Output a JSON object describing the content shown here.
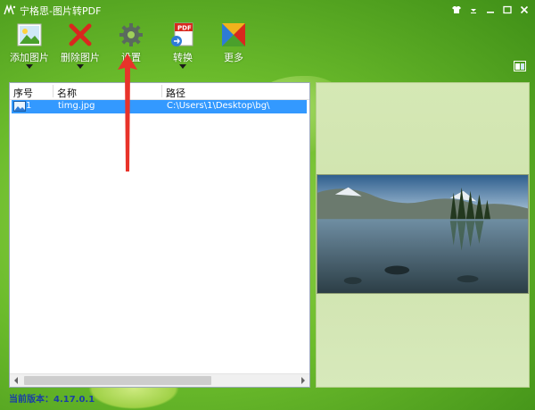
{
  "window": {
    "title": "宁格思-图片转PDF",
    "controls": [
      "shirt-icon",
      "dropdown-icon",
      "minimize-icon",
      "maximize-icon",
      "close-icon"
    ]
  },
  "toolbar": {
    "items": [
      {
        "label": "添加图片",
        "icon": "add-image-icon",
        "has_dropdown": true
      },
      {
        "label": "删除图片",
        "icon": "delete-x-icon",
        "has_dropdown": true
      },
      {
        "label": "设置",
        "icon": "gear-icon",
        "has_dropdown": false
      },
      {
        "label": "转换",
        "icon": "pdf-convert-icon",
        "has_dropdown": true
      },
      {
        "label": "更多",
        "icon": "more-icon",
        "has_dropdown": false
      }
    ]
  },
  "file_list": {
    "columns": [
      "序号",
      "名称",
      "路径"
    ],
    "rows": [
      {
        "index": "1",
        "name": "timg.jpg",
        "path": "C:\\Users\\1\\Desktop\\bg\\",
        "selected": true
      }
    ]
  },
  "status": {
    "version_text": "当前版本：4.17.0.1"
  },
  "colors": {
    "accent_green": "#6cbc2c",
    "selection_blue": "#3399ff",
    "version_blue": "#1a3fa6",
    "annotation_red": "#e8332a"
  }
}
